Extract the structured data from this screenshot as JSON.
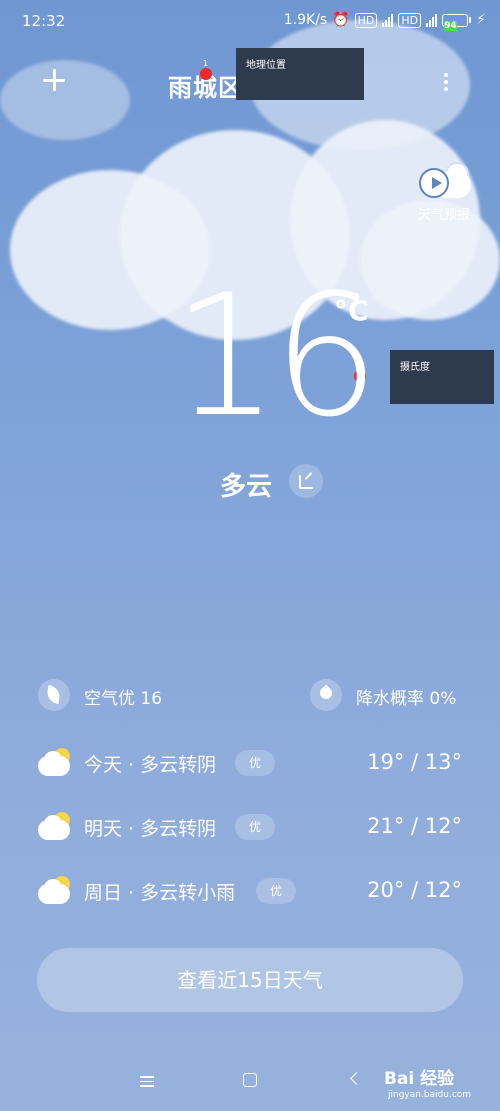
{
  "status": {
    "time": "12:32",
    "speed": "1.9K/s",
    "battery": "94",
    "hd1": "HD",
    "hd2": "HD",
    "net1": "4G",
    "net2": "4G"
  },
  "header": {
    "location": "雨城区 濆江路"
  },
  "tooltips": [
    {
      "num": "1",
      "text": "地理位置"
    },
    {
      "num": "2",
      "text": "摄氏度"
    }
  ],
  "forecast": {
    "label": "天气预报"
  },
  "current": {
    "temp": "16",
    "unit": "°C",
    "condition": "多云"
  },
  "air": {
    "label": "空气优 16"
  },
  "rain": {
    "label": "降水概率 0%"
  },
  "days": [
    {
      "text": "今天 · 多云转阴",
      "aq": "优",
      "temp": "19° / 13°"
    },
    {
      "text": "明天 · 多云转阴",
      "aq": "优",
      "temp": "21° / 12°"
    },
    {
      "text": "周日 · 多云转小雨",
      "aq": "优",
      "temp": "20° / 12°"
    }
  ],
  "button15": "查看近15日天气",
  "watermark": {
    "brand": "Bai 经验",
    "url": "jingyan.baidu.com"
  }
}
